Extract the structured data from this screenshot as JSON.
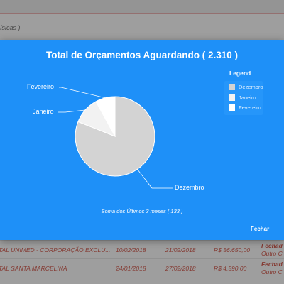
{
  "background": {
    "subtitle": "ísicas )",
    "rows": [
      {
        "client": "TAL UNIMED - CORPORAÇÃO EXCLU...",
        "date1": "10/02/2018",
        "date2": "21/02/2018",
        "value": "R$ 56.650,00",
        "status": "Fechad",
        "status2": "Outro C"
      },
      {
        "client": "TAL SANTA MARCELINA",
        "date1": "24/01/2018",
        "date2": "27/02/2018",
        "value": "R$ 4.590,00",
        "status": "Fechad",
        "status2": "Outro C"
      }
    ]
  },
  "modal": {
    "title": "Total de Orçamentos Aguardando ( 2.310 )",
    "footer_note": "Soma dos Últimos 3 meses ( 133 )",
    "close_label": "Fechar"
  },
  "chart_data": {
    "type": "pie",
    "title": "Total de Orçamentos Aguardando ( 2.310 )",
    "categories": [
      "Dezembro",
      "Janeiro",
      "Fevereiro"
    ],
    "values": [
      81,
      11,
      8
    ],
    "colors": [
      "#d3d3d3",
      "#f2f2f2",
      "#ffffff"
    ],
    "legend": {
      "title": "Legend",
      "position": "right",
      "items": [
        "Dezembro",
        "Janeiro",
        "Fevereiro"
      ]
    }
  }
}
